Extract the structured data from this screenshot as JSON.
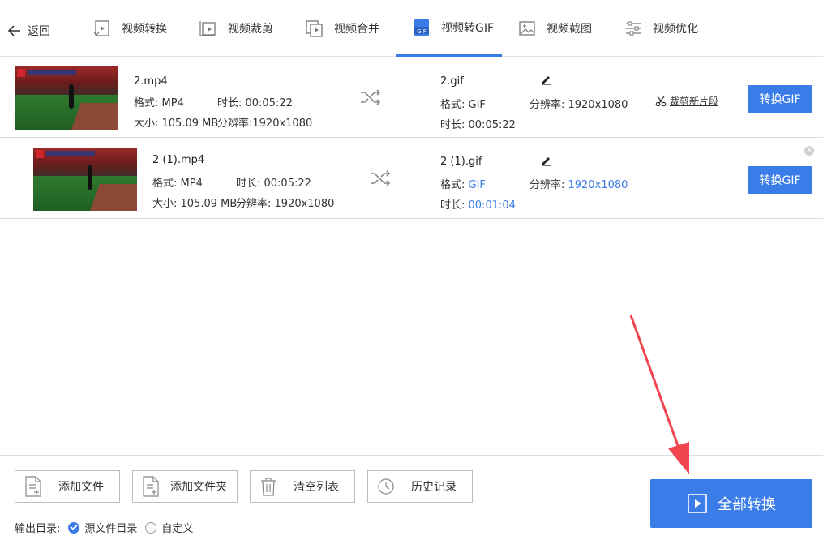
{
  "nav": {
    "back": "返回",
    "tabs": [
      "视频转换",
      "视频裁剪",
      "视频合并",
      "视频转GIF",
      "视频截图",
      "视频优化"
    ],
    "active_index": 3,
    "gif_badge": "GIF"
  },
  "rows": [
    {
      "src_name": "2.mp4",
      "src_format": "格式: MP4",
      "src_duration": "时长: 00:05:22",
      "src_size": "大小: 105.09 MB",
      "src_resolution": "分辨率:1920x1080",
      "out_name": "2.gif",
      "out_format_label": "格式: ",
      "out_format_value": "GIF",
      "out_resolution_label": "分辨率: ",
      "out_resolution_value": "1920x1080",
      "out_duration_label": "时长: ",
      "out_duration_value": "00:05:22",
      "cut_link": "裁剪新片段",
      "convert_label": "转换GIF"
    },
    {
      "src_name": "2 (1).mp4",
      "src_format": "格式: MP4",
      "src_duration": "时长: 00:05:22",
      "src_size": "大小: 105.09 MB",
      "src_resolution": "分辨率: 1920x1080",
      "out_name": "2 (1).gif",
      "out_format_label": "格式: ",
      "out_format_value": "GIF",
      "out_resolution_label": "分辨率: ",
      "out_resolution_value": "1920x1080",
      "out_duration_label": "时长: ",
      "out_duration_value": "00:01:04",
      "convert_label": "转换GIF"
    }
  ],
  "bottom": {
    "add_file": "添加文件",
    "add_folder": "添加文件夹",
    "clear_list": "清空列表",
    "history": "历史记录",
    "output_dir_label": "输出目录:",
    "option_source": "源文件目录",
    "option_custom": "自定义",
    "convert_all": "全部转换"
  },
  "colors": {
    "accent": "#3a7de9",
    "annotation_arrow": "#f0454f"
  }
}
